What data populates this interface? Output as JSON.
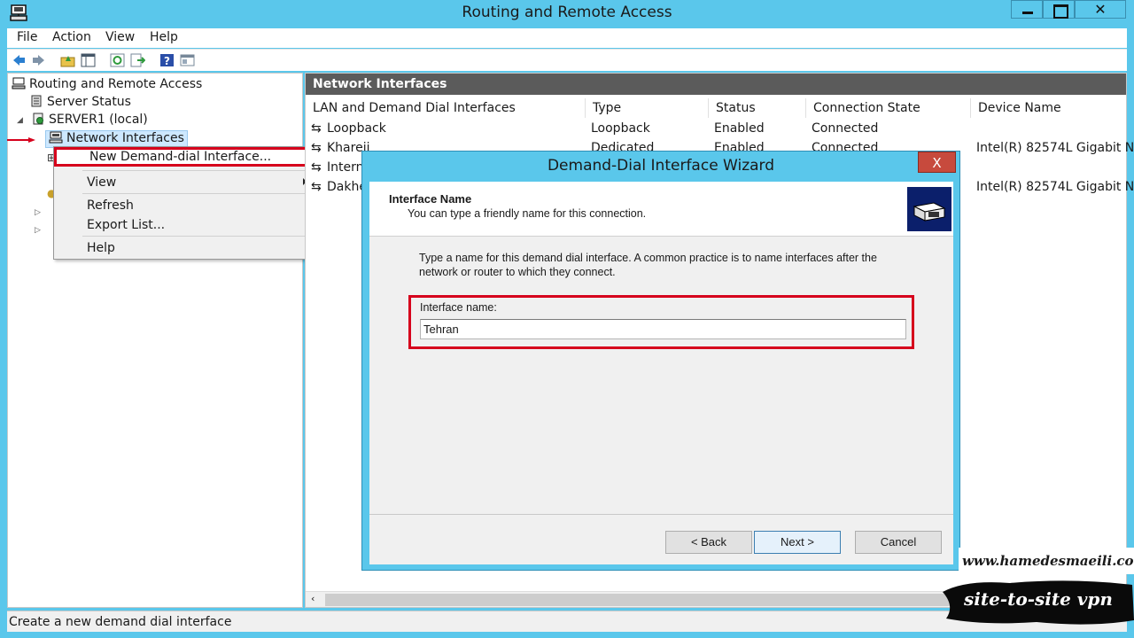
{
  "window": {
    "title": "Routing and Remote Access"
  },
  "menu": [
    "File",
    "Action",
    "View",
    "Help"
  ],
  "toolbar": {
    "icons": [
      "back-arrow-icon",
      "forward-arrow-icon",
      "up-folder-icon",
      "show-hide-tree-icon",
      "refresh-icon",
      "export-list-icon",
      "help-icon",
      "properties-icon"
    ]
  },
  "tree": {
    "root": "Routing and Remote Access",
    "server_status": "Server Status",
    "server": "SERVER1 (local)",
    "network_interfaces": "Network Interfaces"
  },
  "context_menu": {
    "new_interface": "New Demand-dial Interface...",
    "view": "View",
    "refresh": "Refresh",
    "export": "Export List...",
    "help": "Help"
  },
  "pane": {
    "header": "Network Interfaces",
    "columns": [
      "LAN and Demand Dial Interfaces",
      "Type",
      "Status",
      "Connection State",
      "Device Name"
    ],
    "rows": [
      {
        "name": "Loopback",
        "type": "Loopback",
        "status": "Enabled",
        "state": "Connected",
        "device": ""
      },
      {
        "name": "Khareji",
        "type": "Dedicated",
        "status": "Enabled",
        "state": "Connected",
        "device": "Intel(R) 82574L Gigabit N"
      },
      {
        "name": "Intern",
        "type": "",
        "status": "",
        "state": "",
        "device": ""
      },
      {
        "name": "Dakhe",
        "type": "",
        "status": "",
        "state": "",
        "device": "Intel(R) 82574L Gigabit N"
      }
    ]
  },
  "status_bar": "Create a new demand dial interface",
  "wizard": {
    "title": "Demand-Dial Interface Wizard",
    "close_label": "X",
    "heading": "Interface Name",
    "subheading": "You can type a friendly name for this connection.",
    "description": "Type a name for this demand dial interface.  A common practice is to name interfaces after the network or router to which they connect.",
    "field_label": "Interface name:",
    "field_value": "Tehran",
    "back_label": "< Back",
    "next_label": "Next >",
    "cancel_label": "Cancel"
  },
  "watermark": {
    "url": "www.hamedesmaeili.com",
    "tag": "site-to-site vpn"
  },
  "colors": {
    "title_bar": "#5ac7eb",
    "highlight": "#d6001c",
    "pane_header": "#5b5b5b"
  }
}
